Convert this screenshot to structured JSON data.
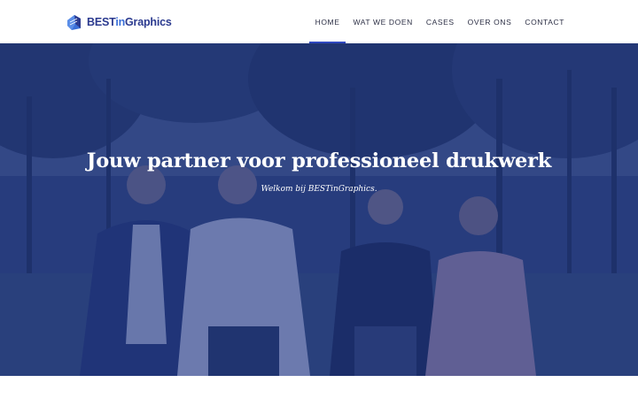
{
  "brand": {
    "name_part1": "BEST",
    "name_part2": "in",
    "name_part3": "Graphics",
    "primary_color": "#2b3a8f",
    "accent_color": "#3a6fd8"
  },
  "nav": {
    "items": [
      {
        "label": "HOME",
        "active": true
      },
      {
        "label": "WAT WE DOEN",
        "active": false
      },
      {
        "label": "CASES",
        "active": false
      },
      {
        "label": "OVER ONS",
        "active": false
      },
      {
        "label": "CONTACT",
        "active": false
      }
    ],
    "active_indicator_color": "#2f48c0"
  },
  "hero": {
    "title": "Jouw partner voor professioneel drukwerk",
    "subtitle": "Welkom bij BESTinGraphics.",
    "overlay_color": "#183080"
  }
}
